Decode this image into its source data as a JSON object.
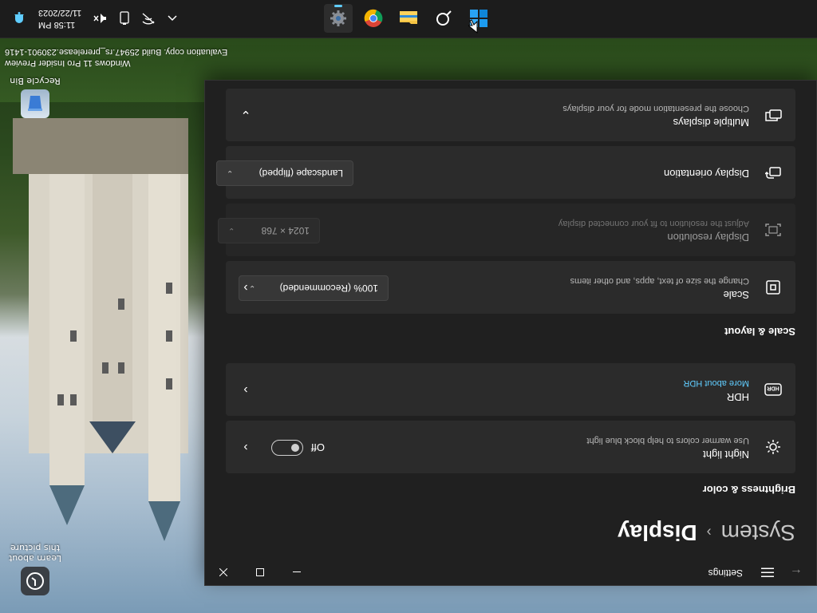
{
  "desktop": {
    "recycle_bin_label": "Recycle Bin",
    "learn_label_1": "Learn about",
    "learn_label_2": "this picture",
    "watermark_line1": "Windows 11 Pro Insider Preview",
    "watermark_line2": "Evaluation copy. Build 25947.rs_prerelease.230901-1416"
  },
  "window": {
    "title": "Settings",
    "breadcrumb_parent": "System",
    "breadcrumb_separator": "›",
    "breadcrumb_current": "Display"
  },
  "sections": {
    "brightness": "Brightness & color",
    "scale": "Scale & layout"
  },
  "cards": {
    "night_light": {
      "title": "Night light",
      "subtitle": "Use warmer colors to help block blue light",
      "toggle_state": "Off"
    },
    "hdr": {
      "title": "HDR",
      "link": "More about HDR"
    },
    "scale": {
      "title": "Scale",
      "subtitle": "Change the size of text, apps, and other items",
      "value": "100% (Recommended)"
    },
    "resolution": {
      "title": "Display resolution",
      "subtitle": "Adjust the resolution to fit your connected display",
      "value": "1024 × 768"
    },
    "orientation": {
      "title": "Display orientation",
      "value": "Landscape (flipped)"
    },
    "multiple": {
      "title": "Multiple displays",
      "subtitle": "Choose the presentation mode for your displays"
    }
  },
  "taskbar": {
    "time": "11:58 PM",
    "date": "11/22/2023",
    "apps": [
      "start-icon",
      "search-icon",
      "file-explorer-icon",
      "chrome-icon",
      "settings-icon"
    ]
  },
  "colors": {
    "accent": "#60cdff",
    "window_bg": "#202020",
    "card_bg": "#2b2b2b",
    "taskbar_bg": "#1c1c1c"
  }
}
